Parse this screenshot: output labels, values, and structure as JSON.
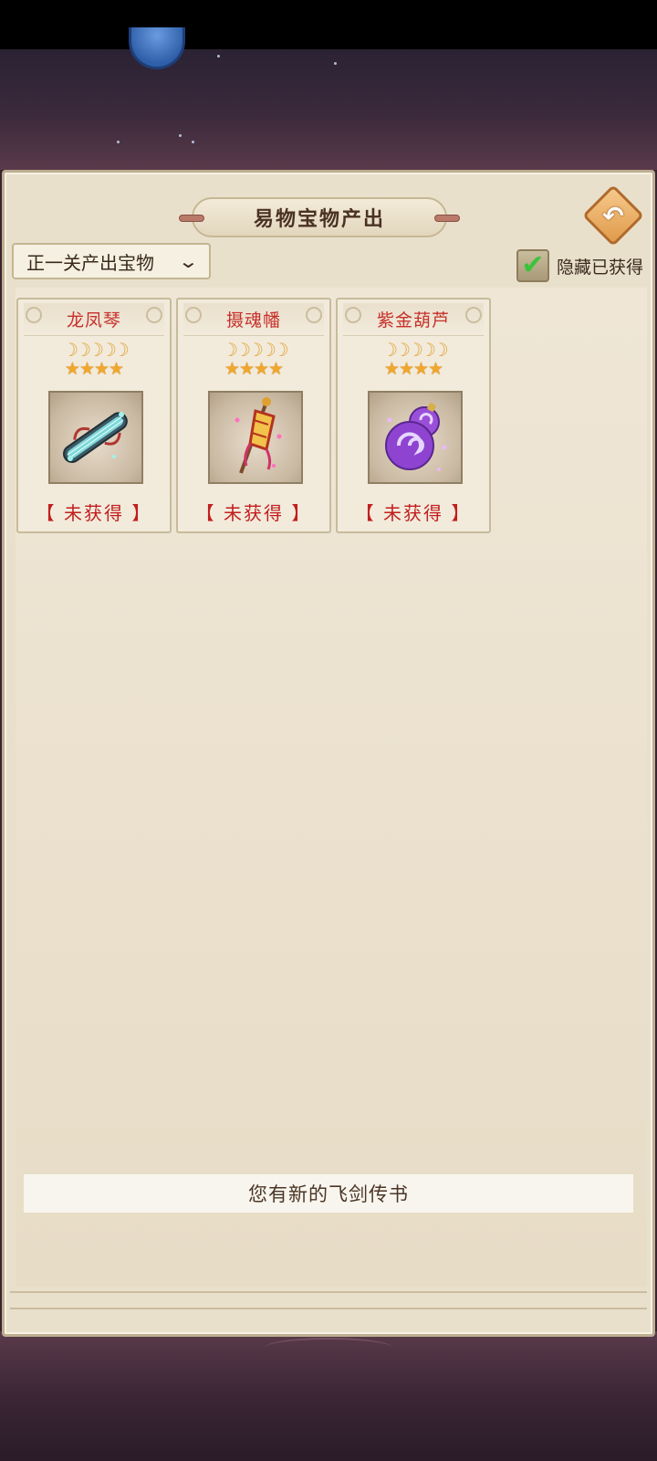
{
  "header": {
    "title": "易物宝物产出",
    "back_icon": "back-arrow-icon",
    "back_glyph": "↶"
  },
  "filter": {
    "dropdown_value": "正一关产出宝物",
    "chevron": "⌄",
    "hide_obtained_label": "隐藏已获得",
    "hide_obtained_checked": true,
    "check_glyph": "✔"
  },
  "items": [
    {
      "name": "龙凤琴",
      "moons": "☽☽☽☽☽",
      "stars": "★★★★",
      "status": "【 未获得 】",
      "icon": "guqin-icon"
    },
    {
      "name": "摄魂幡",
      "moons": "☽☽☽☽☽",
      "stars": "★★★★",
      "status": "【 未获得 】",
      "icon": "banner-icon"
    },
    {
      "name": "紫金葫芦",
      "moons": "☽☽☽☽☽",
      "stars": "★★★★",
      "status": "【 未获得 】",
      "icon": "gourd-icon"
    }
  ],
  "notification": {
    "text": "您有新的飞剑传书"
  },
  "colors": {
    "item_name": "#c8302a",
    "status_not_obtained": "#c21e1e",
    "checkbox_check": "#3bc43b",
    "panel_bg": "#e9e0cc"
  }
}
